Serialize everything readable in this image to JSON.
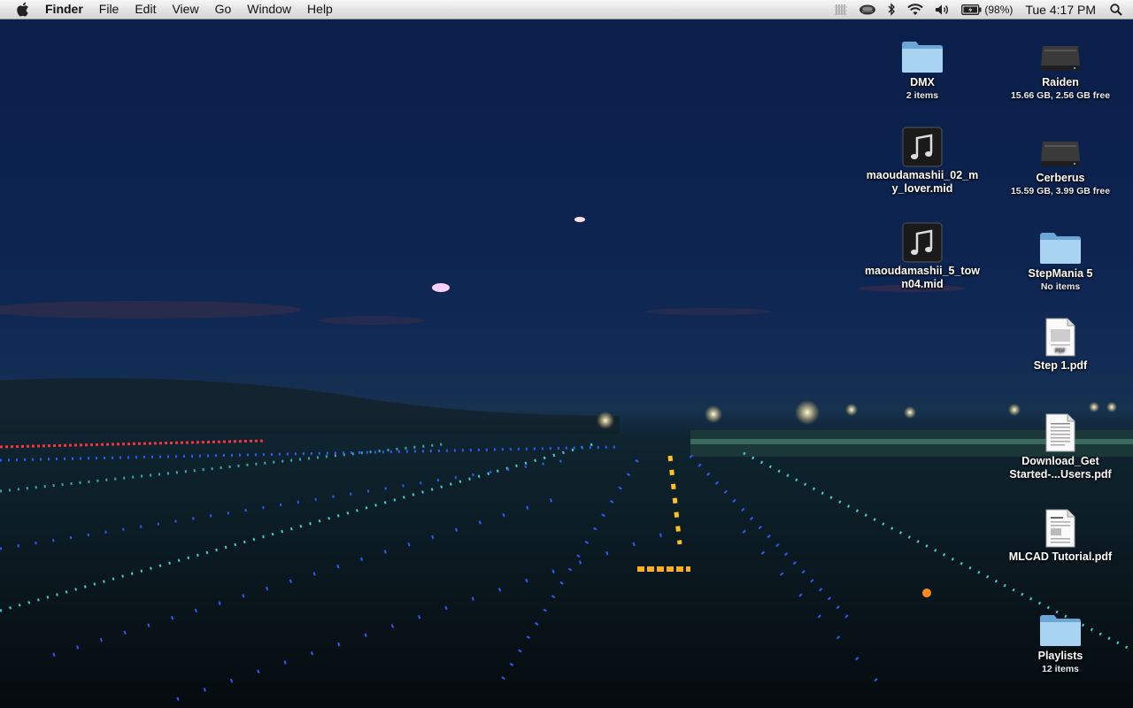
{
  "menubar": {
    "app_name": "Finder",
    "menus": [
      "File",
      "Edit",
      "View",
      "Go",
      "Window",
      "Help"
    ],
    "battery_percent": "(98%)",
    "clock": "Tue 4:17 PM"
  },
  "desktop_icons": [
    {
      "name": "DMX",
      "info": "2 items",
      "kind": "folder-icon"
    },
    {
      "name": "Raiden",
      "info": "15.66 GB, 2.56 GB free",
      "kind": "drive-icon"
    },
    {
      "name": "maoudamashii_02_my_lover.mid",
      "name_line1": "maoudamashii_02_m",
      "name_line2": "y_lover.mid",
      "info": "",
      "kind": "music-file-icon"
    },
    {
      "name": "Cerberus",
      "info": "15.59 GB, 3.99 GB free",
      "kind": "drive-icon"
    },
    {
      "name": "maoudamashii_5_town04.mid",
      "name_line1": "maoudamashii_5_tow",
      "name_line2": "n04.mid",
      "info": "",
      "kind": "music-file-icon"
    },
    {
      "name": "StepMania 5",
      "info": "No items",
      "kind": "folder-icon"
    },
    {
      "name": "Step 1.pdf",
      "info": "",
      "kind": "pdf-icon"
    },
    {
      "name": "Download_Get Started-...Users.pdf",
      "name_line1": "Download_Get",
      "name_line2": "Started-...Users.pdf",
      "info": "",
      "kind": "pdf-icon"
    },
    {
      "name": "MLCAD Tutorial.pdf",
      "info": "",
      "kind": "pdf-icon"
    },
    {
      "name": "Playlists",
      "info": "12 items",
      "kind": "folder-icon"
    }
  ],
  "colors": {
    "sky_top": "#0a1f4a",
    "menubar_bg": "#e4e4e4",
    "folder_blue": "#8fc3e8",
    "runway_blue": "#2a5cff",
    "runway_cyan": "#45e6e6"
  }
}
